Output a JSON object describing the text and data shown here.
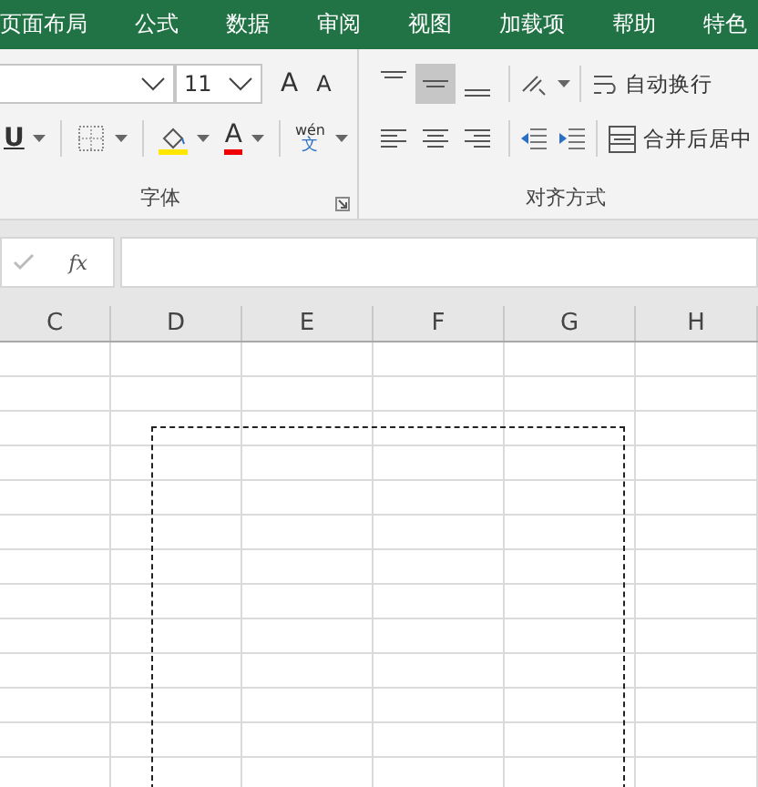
{
  "menu_tabs": [
    {
      "label": "页面布局"
    },
    {
      "label": "公式"
    },
    {
      "label": "数据"
    },
    {
      "label": "审阅"
    },
    {
      "label": "视图"
    },
    {
      "label": "加载项"
    },
    {
      "label": "帮助"
    },
    {
      "label": "特色"
    }
  ],
  "font_group": {
    "font_size": "11",
    "grow_font": "A",
    "shrink_font": "A",
    "underline": "U",
    "font_color_letter": "A",
    "phonetic": {
      "pinyin": "wén",
      "character": "文"
    },
    "label": "字体"
  },
  "alignment_group": {
    "vertical_align": [
      {
        "kind": "top",
        "selected": false
      },
      {
        "kind": "middle",
        "selected": true
      },
      {
        "kind": "bottom",
        "selected": false
      }
    ],
    "horizontal_align": [
      {
        "kind": "left",
        "selected": false
      },
      {
        "kind": "center",
        "selected": false
      },
      {
        "kind": "right",
        "selected": false
      }
    ],
    "wrap_text": "自动换行",
    "merge_center": "合并后居中",
    "label": "对齐方式"
  },
  "formula_bar": {
    "fx": "fx"
  },
  "columns": [
    "C",
    "D",
    "E",
    "F",
    "G",
    "H"
  ]
}
